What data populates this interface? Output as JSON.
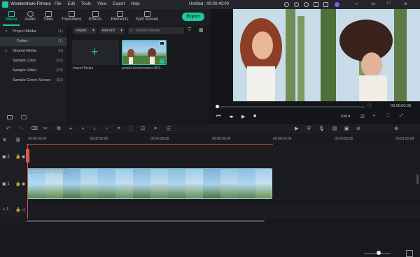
{
  "titlebar": {
    "app_name": "Wondershare Filmora",
    "menu": [
      "File",
      "Edit",
      "Tools",
      "View",
      "Export",
      "Help"
    ],
    "window_title": "Untitled : 00:00:40:00",
    "accent_color": "#1ec8a5"
  },
  "toolbar": {
    "tabs": [
      {
        "label": "Media",
        "icon": "media-icon",
        "active": true
      },
      {
        "label": "Audio",
        "icon": "music-icon",
        "active": false
      },
      {
        "label": "Titles",
        "icon": "text-icon",
        "active": false
      },
      {
        "label": "Transitions",
        "icon": "transition-icon",
        "active": false
      },
      {
        "label": "Effects",
        "icon": "effects-icon",
        "active": false
      },
      {
        "label": "Elements",
        "icon": "elements-icon",
        "active": false
      },
      {
        "label": "Split Screen",
        "icon": "split-screen-icon",
        "active": false
      }
    ],
    "export_label": "Export"
  },
  "leftpanel": {
    "items": [
      {
        "label": "Project Media",
        "count": "(1)",
        "expanded": true
      },
      {
        "label": "Folder",
        "count": "(1)",
        "selected": true
      },
      {
        "label": "Shared Media",
        "count": "(0)",
        "expanded": false
      },
      {
        "label": "Sample Color",
        "count": "(25)"
      },
      {
        "label": "Sample Video",
        "count": "(20)"
      },
      {
        "label": "Sample Green Screen",
        "count": "(10)"
      }
    ]
  },
  "media": {
    "import_label": "Import",
    "record_label": "Record",
    "search_placeholder": "Search media",
    "import_tile_label": "Import Media",
    "clip_label": "pexels-koolshooters-853..."
  },
  "preview": {
    "current_time": "00:00:00:00",
    "quality": "Full",
    "progress": 0.0
  },
  "timeline": {
    "ruler_labels": [
      "00:00:00:00",
      "00:00:10:00",
      "00:00:20:00",
      "00:00:30:00",
      "00:00:40:00",
      "00:00:50:00",
      "00:01:00:00"
    ],
    "clip_label": "pexels-koolshooters-853...",
    "track_labels": [
      "2",
      "1",
      "1"
    ]
  }
}
